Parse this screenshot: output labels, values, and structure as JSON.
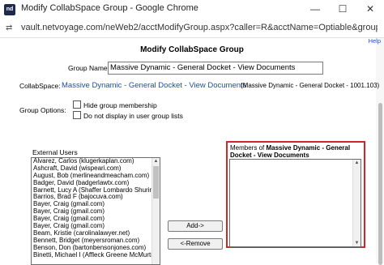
{
  "window": {
    "title": "Modify CollabSpace Group - Google Chrome",
    "logo_text": "nd",
    "minimize": "—",
    "maximize": "☐",
    "close": "✕"
  },
  "address": {
    "icon": "⇄",
    "url": "vault.netvoyage.com/neWeb2/acctModifyGroup.aspx?caller=R&acctName=Optiable&group..."
  },
  "help_link": "Help",
  "heading": "Modify CollabSpace Group",
  "form": {
    "group_name_label": "Group Name:",
    "group_name_value": "Massive Dynamic - General Docket - View Documents",
    "collabspace_label": "CollabSpace:",
    "collabspace_link": "Massive Dynamic - General Docket - View Documents",
    "collabspace_detail": "(Massive Dynamic - General Docket - 1001.103)",
    "group_options_label": "Group Options:",
    "option_hide": "Hide group membership",
    "option_no_display": "Do not display in user group lists"
  },
  "external_users": {
    "label": "External Users",
    "items": [
      "Alvarez, Carlos (klugerkaplan.com)",
      "Ashcraft, David (wispeari.com)",
      "August, Bob (merlineandmeacham.com)",
      "Badger, David (badgerlawtx.com)",
      "Barnett, Lucy A (Shaffer Lombardo Shurin)",
      "Barrios, Brad F (bajocuva.com)",
      "Bayer, Craig (gmail.com)",
      "Bayer, Craig (gmail.com)",
      "Bayer, Craig (gmail.com)",
      "Bayer, Craig (gmail.com)",
      "Beam, Kristie (carolinalawyer.net)",
      "Bennett, Bridget (meyersroman.com)",
      "Benson, Don (bartonbensonjones.com)",
      "Binetti, Michael I (Affleck Greene McMurtry"
    ]
  },
  "buttons": {
    "add": "Add->",
    "remove": "<-Remove"
  },
  "members": {
    "label_prefix": "Members of ",
    "label_bold": "Massive Dynamic - General Docket - View Documents"
  },
  "colors": {
    "link": "#1a4fb0",
    "highlight": "#d0282a"
  }
}
